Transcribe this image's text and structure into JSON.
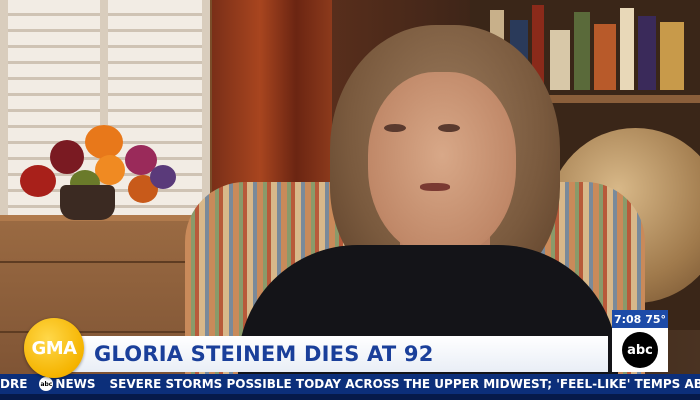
{
  "broadcast": {
    "show_logo": "GMA",
    "network_logo": "abc",
    "headline": "GLORIA STEINEM DIES AT 92",
    "clock": {
      "time": "7:08",
      "temperature": "75°"
    },
    "ticker": {
      "lead_fragment": "DRE",
      "brand_logo": "abc",
      "brand_word": "NEWS",
      "text": "SEVERE STORMS POSSIBLE TODAY ACROSS THE UPPER MIDWEST; 'FEEL-LIKE' TEMPS ABOVE"
    }
  },
  "colors": {
    "headline_text": "#1a3f9a",
    "ticker_background": "#0c2f7a",
    "gma_yellow": "#f5b400",
    "clock_background": "#1d4ba8"
  },
  "icons": [
    "gma-logo-icon",
    "abc-logo-icon",
    "abc-news-icon"
  ]
}
